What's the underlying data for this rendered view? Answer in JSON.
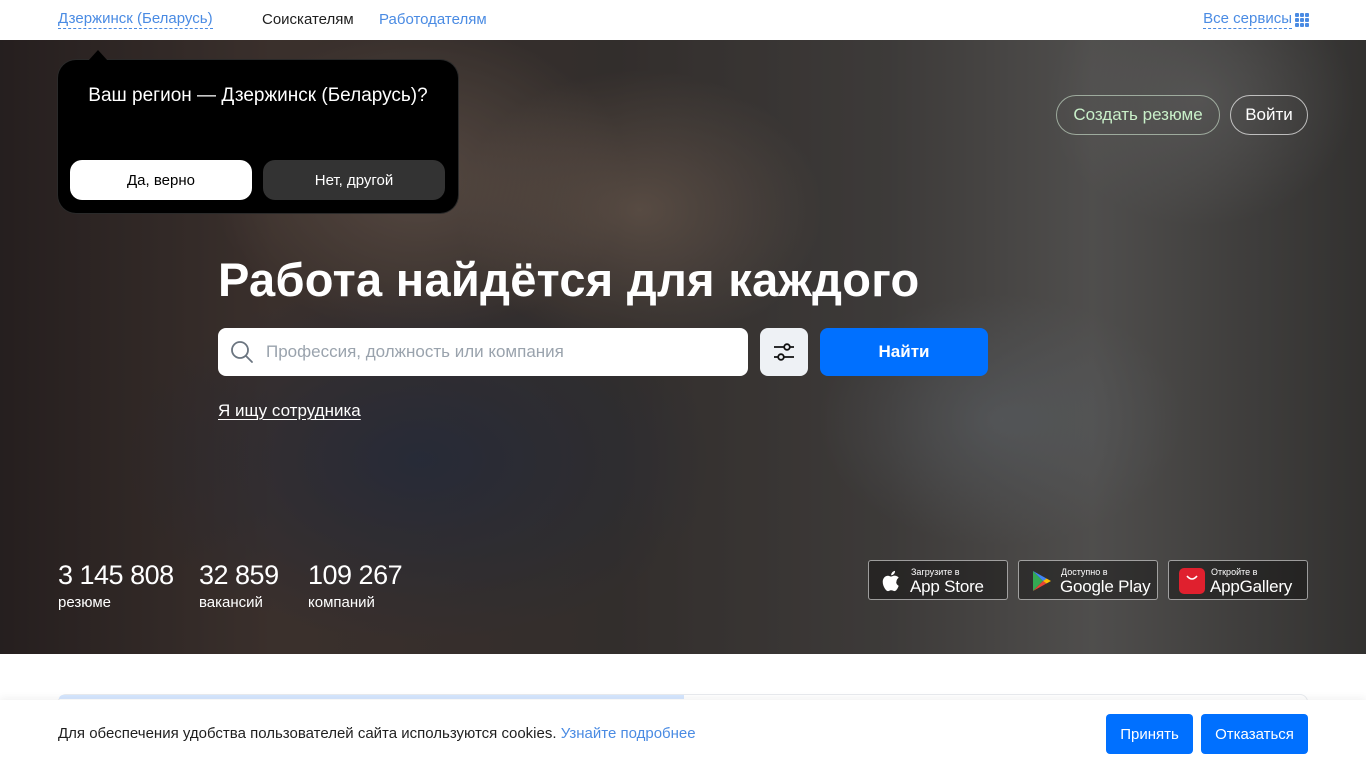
{
  "header": {
    "region": "Дзержинск (Беларусь)",
    "nav_seekers": "Соискателям",
    "nav_employers": "Работодателям",
    "all_services": "Все сервисы"
  },
  "region_popup": {
    "question": "Ваш регион — Дзержинск (Беларусь)?",
    "yes_label": "Да, верно",
    "no_label": "Нет, другой"
  },
  "hero": {
    "create_resume": "Создать резюме",
    "login": "Войти",
    "title": "Работа найдётся для каждого",
    "search_placeholder": "Профессия, должность или компания",
    "find_button": "Найти",
    "employer_link": "Я ищу сотрудника"
  },
  "stats": [
    {
      "number": "3 145 808",
      "label": "резюме"
    },
    {
      "number": "32 859",
      "label": "вакансий"
    },
    {
      "number": "109 267",
      "label": "компаний"
    }
  ],
  "stores": [
    {
      "small": "Загрузите в",
      "big": "App Store"
    },
    {
      "small": "Доступно в",
      "big": "Google Play"
    },
    {
      "small": "Откройте в",
      "big": "AppGallery"
    }
  ],
  "cookie": {
    "text": "Для обеспечения удобства пользователей сайта используются cookies.",
    "more": "Узнайте подробнее",
    "accept": "Принять",
    "decline": "Отказаться"
  },
  "colors": {
    "accent": "#0070ff",
    "link": "#4a8be3"
  }
}
